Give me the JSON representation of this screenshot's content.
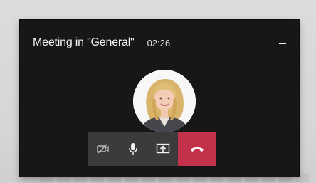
{
  "window": {
    "title": "Meeting in \"General\"",
    "timer": "02:26"
  },
  "controls": [
    {
      "icon": "video-off-icon"
    },
    {
      "icon": "microphone-icon"
    },
    {
      "icon": "share-screen-icon"
    },
    {
      "icon": "hang-up-icon"
    }
  ],
  "colors": {
    "window_bg": "#171717",
    "control_bg": "#3b3b3b",
    "hangup": "#c4314b",
    "text": "#f5f5f5"
  }
}
